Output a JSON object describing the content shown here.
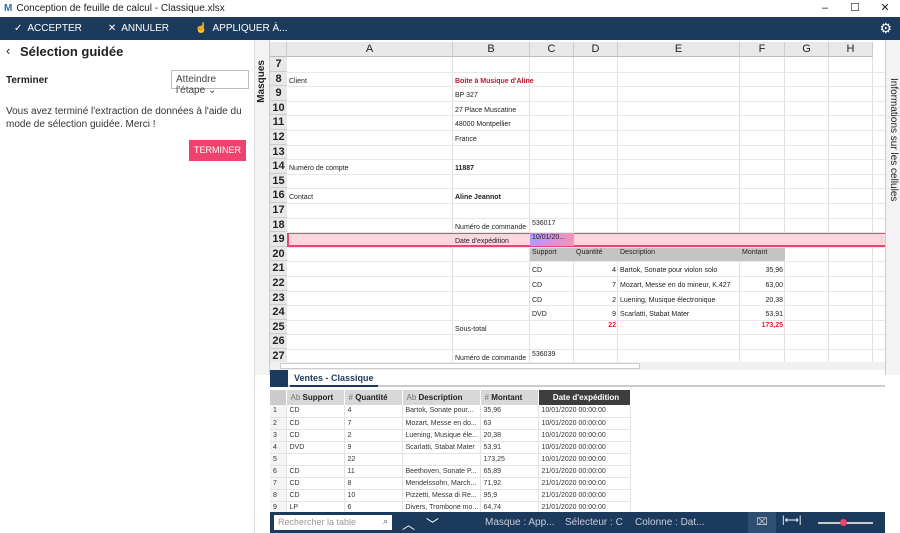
{
  "window": {
    "title": "Conception de feuille de calcul - Classique.xlsx",
    "logo": "M"
  },
  "toolbar": {
    "accept": "ACCEPTER",
    "cancel": "ANNULER",
    "apply": "APPLIQUER À..."
  },
  "left": {
    "title": "Sélection guidée",
    "finish_label": "Terminer",
    "select_value": "Atteindre l'étape",
    "message": "Vous avez terminé l'extraction de données à l'aide du mode de sélection guidée. Merci !",
    "finish_button": "TERMINER"
  },
  "side_left": "Masques",
  "side_right": "Informations sur les cellules",
  "columns": [
    "A",
    "B",
    "C",
    "D",
    "E",
    "F",
    "G",
    "H"
  ],
  "rows": [
    "7",
    "8",
    "9",
    "10",
    "11",
    "12",
    "13",
    "14",
    "15",
    "16",
    "17",
    "18",
    "19",
    "20",
    "21",
    "22",
    "23",
    "24",
    "25",
    "26",
    "27"
  ],
  "cells": [
    {
      "r": 1,
      "c": "A",
      "t": "Client"
    },
    {
      "r": 1,
      "c": "B",
      "t": "Boite à Musique d'Aline",
      "s": "red"
    },
    {
      "r": 2,
      "c": "B",
      "t": "BP 327"
    },
    {
      "r": 3,
      "c": "B",
      "t": "27 Place Muscatine"
    },
    {
      "r": 4,
      "c": "B",
      "t": "48000 Montpellier"
    },
    {
      "r": 5,
      "c": "B",
      "t": "France"
    },
    {
      "r": 7,
      "c": "A",
      "t": "Numéro de compte"
    },
    {
      "r": 7,
      "c": "B",
      "t": "11887",
      "s": "bold"
    },
    {
      "r": 9,
      "c": "A",
      "t": "Contact"
    },
    {
      "r": 9,
      "c": "B",
      "t": "Aline Jeannot",
      "s": "bold"
    },
    {
      "r": 11,
      "c": "B",
      "t": "Numéro de commande"
    },
    {
      "r": 11,
      "c": "C",
      "t": "536017",
      "s": "top"
    },
    {
      "r": 12,
      "c": "B",
      "t": "Date d'expédition"
    },
    {
      "r": 12,
      "c": "C",
      "t": "10/01/20...",
      "s": "top"
    },
    {
      "r": 13,
      "c": "C",
      "t": "Support",
      "s": "hdr"
    },
    {
      "r": 13,
      "c": "D",
      "t": "Quantité",
      "s": "hdr"
    },
    {
      "r": 13,
      "c": "E",
      "t": "Description",
      "s": "hdr"
    },
    {
      "r": 13,
      "c": "F",
      "t": "Montant",
      "s": "hdr"
    },
    {
      "r": 14,
      "c": "C",
      "t": "CD"
    },
    {
      "r": 14,
      "c": "D",
      "t": "4",
      "s": "right"
    },
    {
      "r": 14,
      "c": "E",
      "t": "Bartok, Sonate pour violon solo"
    },
    {
      "r": 14,
      "c": "F",
      "t": "35,96",
      "s": "right"
    },
    {
      "r": 15,
      "c": "C",
      "t": "CD"
    },
    {
      "r": 15,
      "c": "D",
      "t": "7",
      "s": "right"
    },
    {
      "r": 15,
      "c": "E",
      "t": "Mozart, Messe en do mineur, K.427"
    },
    {
      "r": 15,
      "c": "F",
      "t": "63,00",
      "s": "right"
    },
    {
      "r": 16,
      "c": "C",
      "t": "CD"
    },
    {
      "r": 16,
      "c": "D",
      "t": "2",
      "s": "right"
    },
    {
      "r": 16,
      "c": "E",
      "t": "Luening, Musique électronique"
    },
    {
      "r": 16,
      "c": "F",
      "t": "20,38",
      "s": "right"
    },
    {
      "r": 17,
      "c": "C",
      "t": "DVD"
    },
    {
      "r": 17,
      "c": "D",
      "t": "9",
      "s": "right"
    },
    {
      "r": 17,
      "c": "E",
      "t": "Scarlatti, Stabat Mater"
    },
    {
      "r": 17,
      "c": "F",
      "t": "53,91",
      "s": "right"
    },
    {
      "r": 18,
      "c": "B",
      "t": "Sous-total"
    },
    {
      "r": 18,
      "c": "D",
      "t": "22",
      "s": "redr"
    },
    {
      "r": 18,
      "c": "F",
      "t": "173,25",
      "s": "redr"
    },
    {
      "r": 20,
      "c": "C",
      "t": "536039",
      "s": "top"
    },
    {
      "r": 20,
      "c": "B",
      "t": "Numéro de commande"
    }
  ],
  "sheet_tab": "Ventes - Classique",
  "table": {
    "headers": [
      {
        "type": "Ab",
        "label": "Support"
      },
      {
        "type": "#",
        "label": "Quantité"
      },
      {
        "type": "Ab",
        "label": "Description"
      },
      {
        "type": "#",
        "label": "Montant"
      },
      {
        "type": "",
        "label": "Date d'expédition"
      }
    ],
    "rows": [
      [
        "1",
        "CD",
        "4",
        "Bartok, Sonate pour...",
        "35,96",
        "10/01/2020 00:00:00"
      ],
      [
        "2",
        "CD",
        "7",
        "Mozart, Messe en do...",
        "63",
        "10/01/2020 00:00:00"
      ],
      [
        "3",
        "CD",
        "2",
        "Luening, Musique éle...",
        "20,38",
        "10/01/2020 00:00:00"
      ],
      [
        "4",
        "DVD",
        "9",
        "Scarlatti, Stabat Mater",
        "53,91",
        "10/01/2020 00:00:00"
      ],
      [
        "5",
        "",
        "22",
        "",
        "173,25",
        "10/01/2020 00:00:00"
      ],
      [
        "6",
        "CD",
        "11",
        "Beethoven, Sonate P...",
        "65,89",
        "21/01/2020 00:00:00"
      ],
      [
        "7",
        "CD",
        "8",
        "Mendelssohn, March...",
        "71,92",
        "21/01/2020 00:00:00"
      ],
      [
        "8",
        "CD",
        "10",
        "Pizzetti, Messa di Re...",
        "95,9",
        "21/01/2020 00:00:00"
      ],
      [
        "9",
        "LP",
        "6",
        "Divers, Trombone mo...",
        "64,74",
        "21/01/2020 00:00:00"
      ]
    ]
  },
  "status": {
    "search_placeholder": "Rechercher la table",
    "mask": "Masque : App...",
    "selector": "Sélecteur : C",
    "column": "Colonne : Dat...",
    "zoom_level": 0.4
  },
  "colors": {
    "navy": "#1b3a5c",
    "accent": "#f0426e",
    "selection": "#ffd6e0"
  }
}
